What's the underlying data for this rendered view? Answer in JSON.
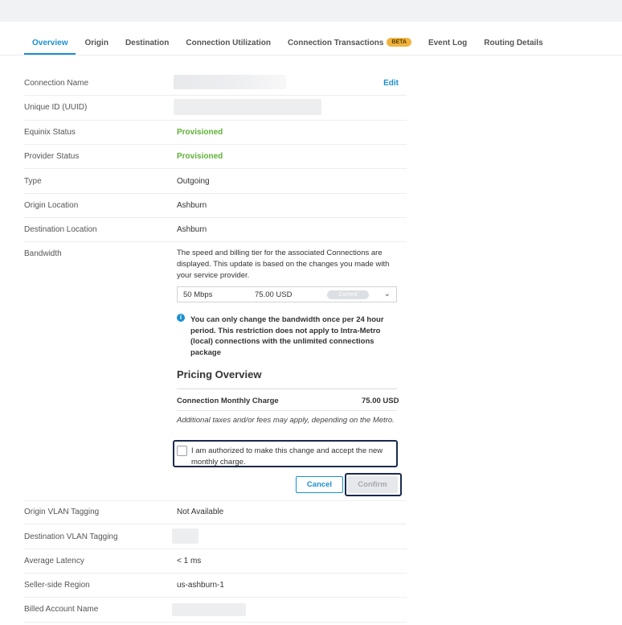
{
  "tabs": [
    {
      "label": "Overview",
      "active": true
    },
    {
      "label": "Origin",
      "active": false
    },
    {
      "label": "Destination",
      "active": false
    },
    {
      "label": "Connection Utilization",
      "active": false
    },
    {
      "label": "Connection Transactions",
      "active": false,
      "badge": "BETA"
    },
    {
      "label": "Event Log",
      "active": false
    },
    {
      "label": "Routing Details",
      "active": false
    }
  ],
  "details": {
    "connection_name": {
      "label": "Connection Name",
      "edit": "Edit"
    },
    "uuid": {
      "label": "Unique ID (UUID)"
    },
    "equinix_status": {
      "label": "Equinix Status",
      "value": "Provisioned"
    },
    "provider_status": {
      "label": "Provider Status",
      "value": "Provisioned"
    },
    "type": {
      "label": "Type",
      "value": "Outgoing"
    },
    "origin_location": {
      "label": "Origin Location",
      "value": "Ashburn"
    },
    "destination_location": {
      "label": "Destination Location",
      "value": "Ashburn"
    },
    "bandwidth": {
      "label": "Bandwidth"
    },
    "origin_vlan": {
      "label": "Origin VLAN Tagging",
      "value": "Not Available"
    },
    "destination_vlan": {
      "label": "Destination VLAN Tagging"
    },
    "latency": {
      "label": "Average Latency",
      "value": "< 1 ms"
    },
    "seller_region": {
      "label": "Seller-side Region",
      "value": "us-ashburn-1"
    },
    "billed_account": {
      "label": "Billed Account Name"
    }
  },
  "bandwidth": {
    "description": "The speed and billing tier for the associated Connections are displayed. This update is based on the changes you made with your service provider.",
    "selected_speed": "50 Mbps",
    "selected_price": "75.00 USD",
    "current_badge": "Current",
    "info": "You can only change the bandwidth once per 24 hour period. This restriction does not apply to Intra-Metro (local) connections with the unlimited connections package"
  },
  "pricing": {
    "title": "Pricing Overview",
    "charge_label": "Connection Monthly Charge",
    "charge_value": "75.00 USD",
    "taxes_note": "Additional taxes and/or fees may apply, depending on the Metro.",
    "authorize_text": "I am authorized to make this change and accept the new monthly charge.",
    "authorized_checked": false
  },
  "actions": {
    "cancel": "Cancel",
    "confirm": "Confirm"
  },
  "colors": {
    "accent": "#1a8fcf",
    "success": "#5fb136",
    "badge": "#f0b33e"
  }
}
